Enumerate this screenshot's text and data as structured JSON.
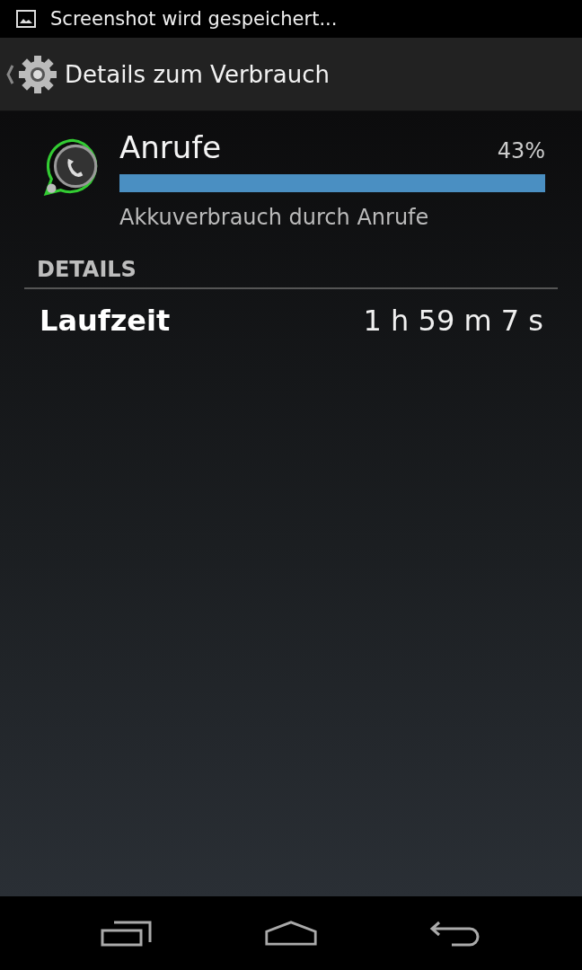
{
  "status_bar": {
    "notification": "Screenshot wird gespeichert..."
  },
  "action_bar": {
    "title": "Details zum Verbrauch"
  },
  "app": {
    "name": "Anrufe",
    "percent": "43%",
    "description": "Akkuverbrauch durch Anrufe"
  },
  "details": {
    "header": "DETAILS",
    "rows": [
      {
        "label": "Laufzeit",
        "value": "1 h 59 m 7 s"
      }
    ]
  }
}
